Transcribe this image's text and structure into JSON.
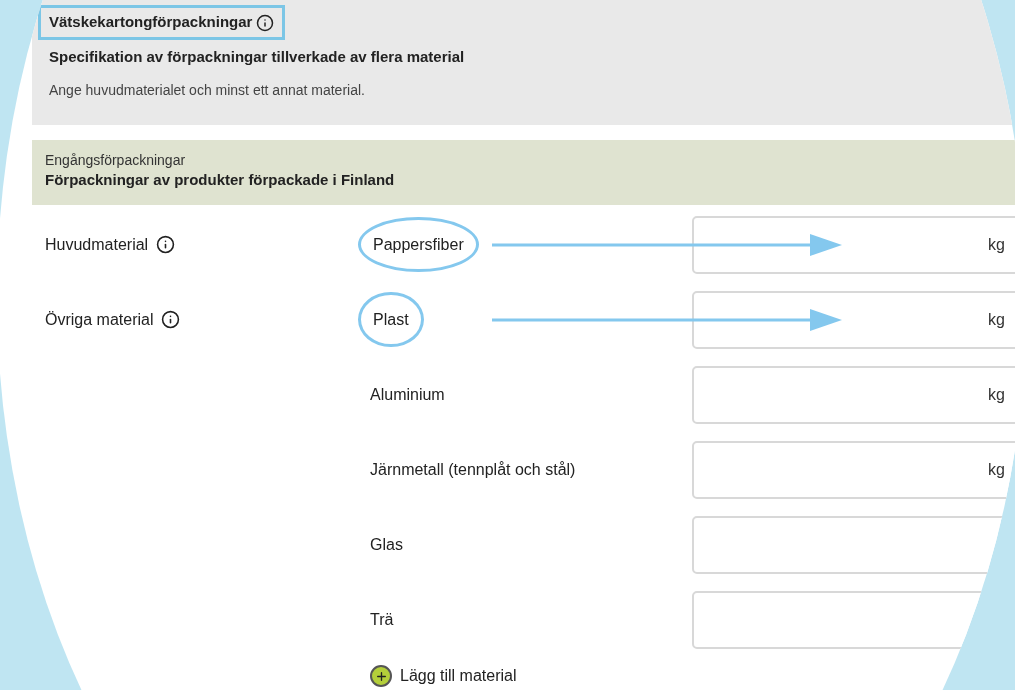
{
  "section": {
    "title": "Vätskekartongförpackningar",
    "highlighted": true,
    "subtitle": "Specifikation av förpackningar tillverkade av flera material",
    "description": "Ange huvudmaterialet och minst ett annat material."
  },
  "category": {
    "title": "Engångsförpackningar",
    "subtitle": "Förpackningar av produkter förpackade i Finland"
  },
  "rows": [
    {
      "label": "Huvudmaterial",
      "material": "Pappersfiber",
      "highlighted": true,
      "unit": "kg"
    },
    {
      "label": "Övriga material",
      "material": "Plast",
      "highlighted": true,
      "unit": "kg"
    },
    {
      "material": "Aluminium",
      "highlighted": false,
      "unit": "kg"
    },
    {
      "material": "Järnmetall (tennplåt och stål)",
      "highlighted": false,
      "unit": "kg"
    },
    {
      "material": "Glas",
      "highlighted": false
    },
    {
      "material": "Trä",
      "highlighted": false
    }
  ],
  "add_button": {
    "label": "Lägg till material"
  }
}
